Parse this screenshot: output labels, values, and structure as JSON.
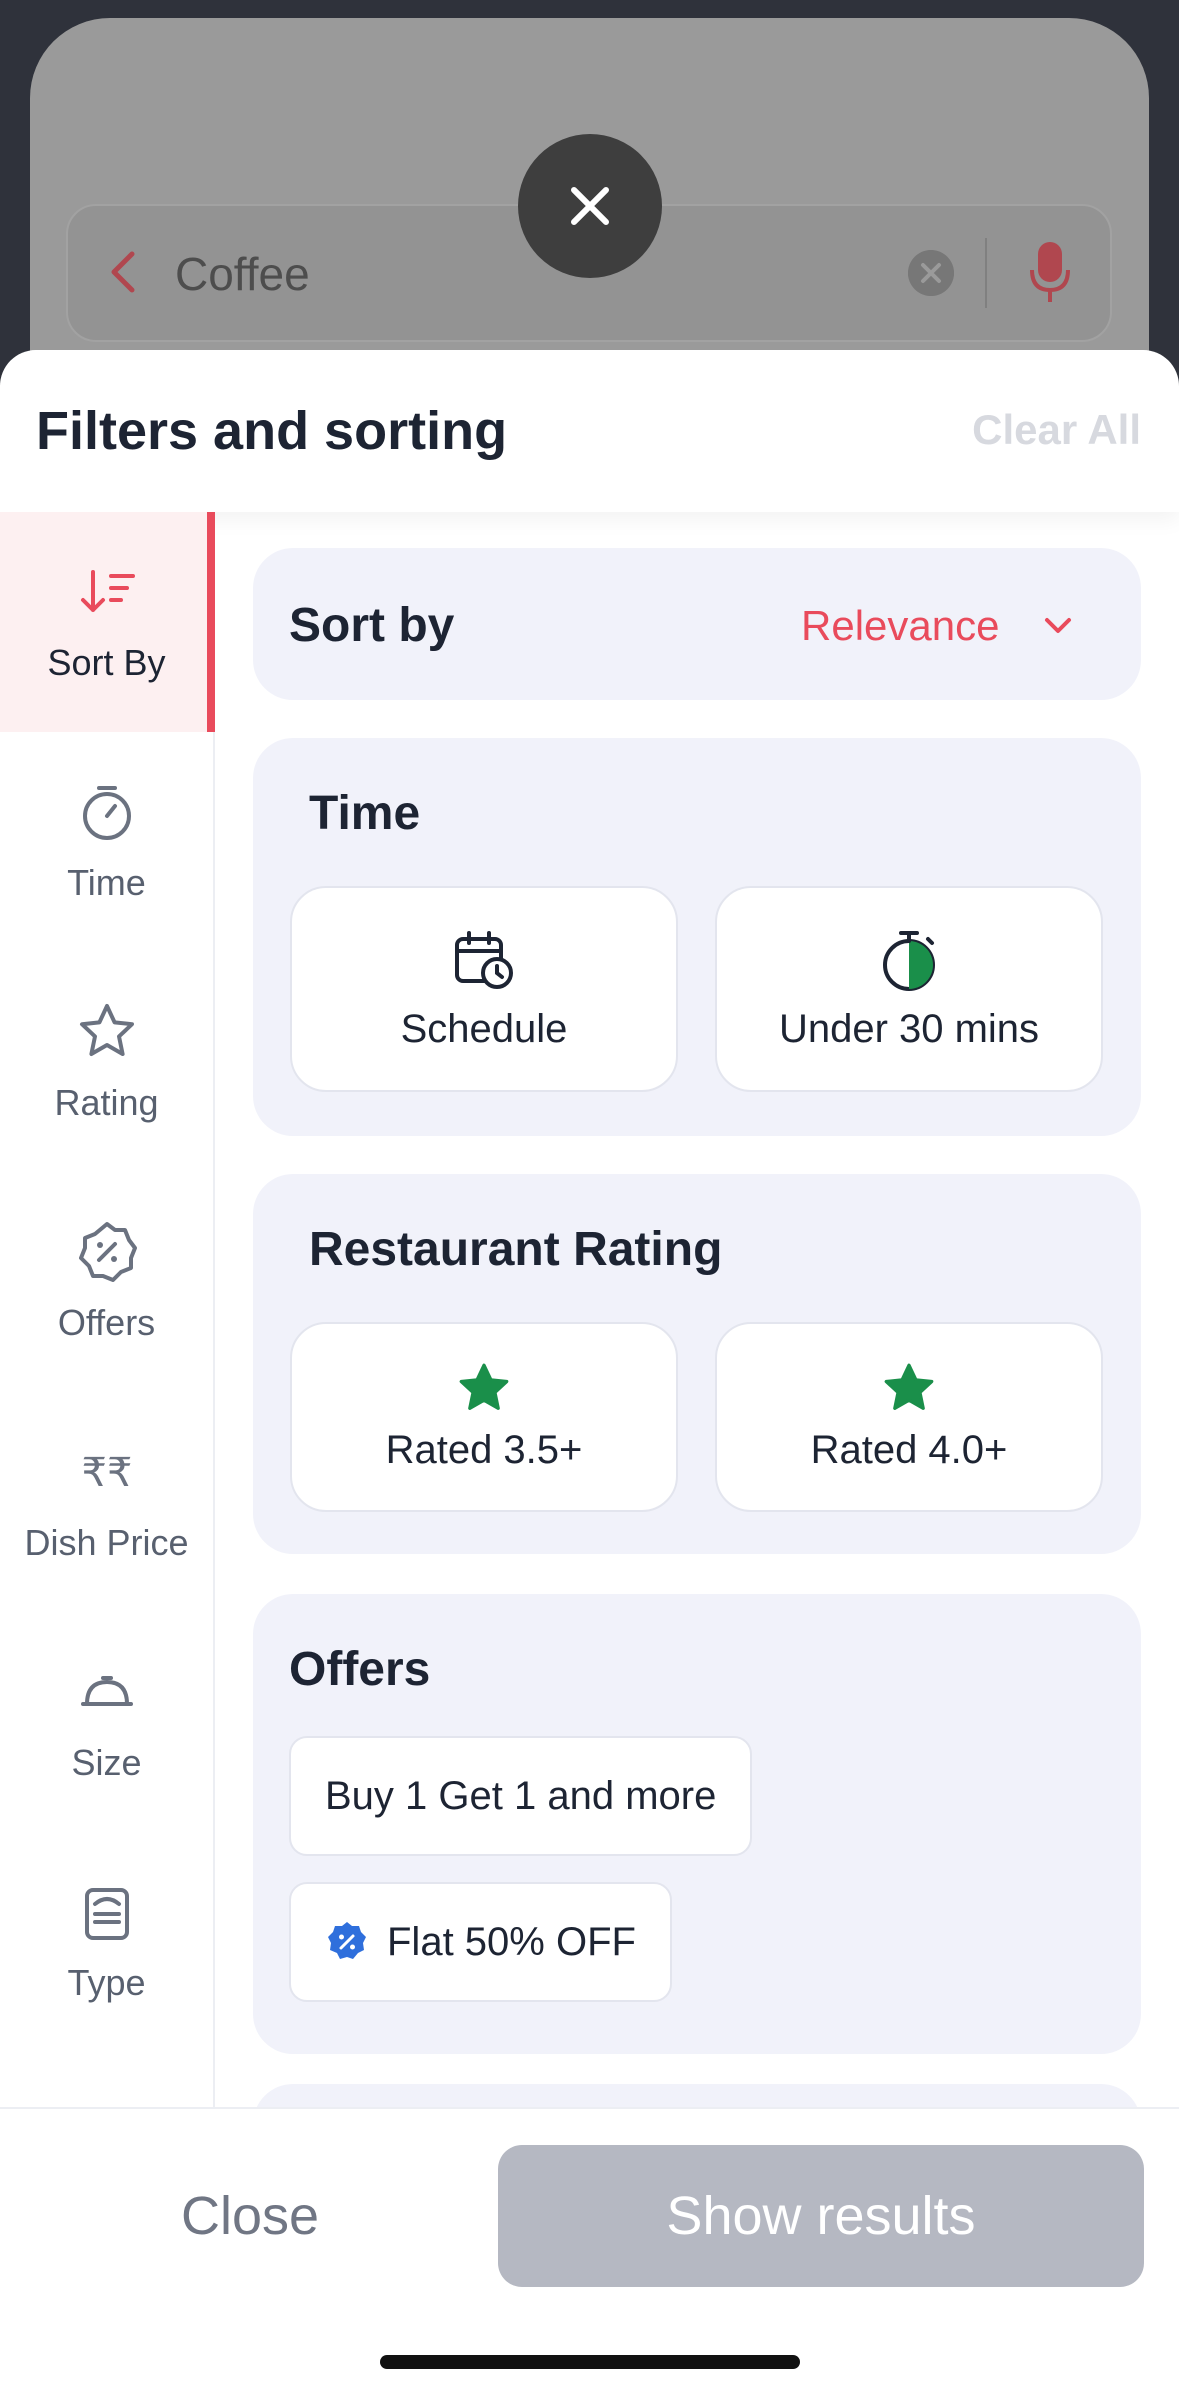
{
  "background": {
    "search_query": "Coffee",
    "back_icon": "chevron-left-icon",
    "clear_icon": "clear-circle-icon",
    "mic_icon": "microphone-icon"
  },
  "overlay_close_icon": "close-icon",
  "sheet": {
    "title": "Filters and sorting",
    "clear_all": "Clear All"
  },
  "nav": {
    "items": [
      {
        "label": "Sort By",
        "icon": "sort-icon"
      },
      {
        "label": "Time",
        "icon": "stopwatch-icon"
      },
      {
        "label": "Rating",
        "icon": "star-icon"
      },
      {
        "label": "Offers",
        "icon": "discount-badge-icon"
      },
      {
        "label": "Dish Price",
        "icon": "rupee-icon"
      },
      {
        "label": "Size",
        "icon": "cloche-icon"
      },
      {
        "label": "Type",
        "icon": "menu-card-icon"
      }
    ]
  },
  "sort_by": {
    "label": "Sort by",
    "value": "Relevance"
  },
  "time": {
    "title": "Time",
    "options": [
      {
        "label": "Schedule",
        "icon": "calendar-clock-icon"
      },
      {
        "label": "Under 30 mins",
        "icon": "timer-icon"
      }
    ]
  },
  "rating": {
    "title": "Restaurant Rating",
    "options": [
      {
        "label": "Rated 3.5+",
        "icon": "green-star-icon"
      },
      {
        "label": "Rated 4.0+",
        "icon": "green-star-icon"
      }
    ]
  },
  "offers": {
    "title": "Offers",
    "options": [
      {
        "label": "Buy 1 Get 1 and more"
      },
      {
        "label": "Flat 50% OFF",
        "icon": "blue-discount-badge-icon"
      }
    ]
  },
  "footer": {
    "close": "Close",
    "show_results": "Show results"
  },
  "colors": {
    "accent": "#e94b5c",
    "rating_green": "#1a8f4a",
    "disabled_button": "#b5b8c2"
  }
}
